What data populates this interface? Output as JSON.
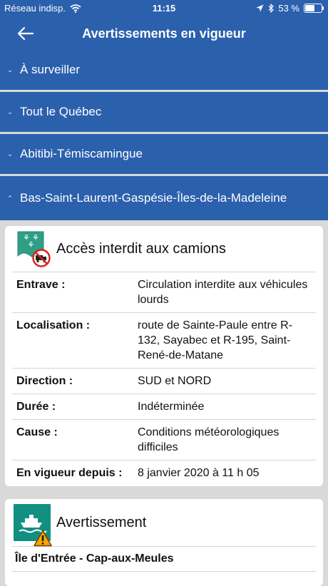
{
  "status": {
    "carrier": "Réseau indisp.",
    "time": "11:15",
    "battery": "53 %",
    "battery_level": 0.53
  },
  "nav": {
    "title": "Avertissements en vigueur"
  },
  "accordion": [
    {
      "label": "À surveiller"
    },
    {
      "label": "Tout le Québec"
    },
    {
      "label": "Abitibi-Témiscamingue"
    },
    {
      "label": "Bas-Saint-Laurent-Gaspésie-Îles-de-la-Madeleine"
    }
  ],
  "card1": {
    "title": "Accès interdit aux camions",
    "rows": [
      {
        "key": "Entrave :",
        "value": "Circulation interdite aux véhicules lourds"
      },
      {
        "key": "Localisation :",
        "value": "route de Sainte-Paule entre R-132, Sayabec et R-195, Saint-René-de-Matane"
      },
      {
        "key": "Direction :",
        "value": "SUD et NORD"
      },
      {
        "key": "Durée :",
        "value": "Indéterminée"
      },
      {
        "key": "Cause :",
        "value": "Conditions météorologiques difficiles"
      },
      {
        "key": "En vigueur depuis :",
        "value": "8 janvier 2020 à 11 h 05"
      }
    ]
  },
  "card2": {
    "title": "Avertissement",
    "row": "Île d'Entrée - Cap-aux-Meules"
  },
  "colors": {
    "primary": "#2b60ad",
    "background": "#d9d9d9",
    "sign_green": "#2f9e86",
    "ferry_teal": "#138f82",
    "warning_orange": "#f2a600",
    "prohibit_red": "#d9201c"
  }
}
